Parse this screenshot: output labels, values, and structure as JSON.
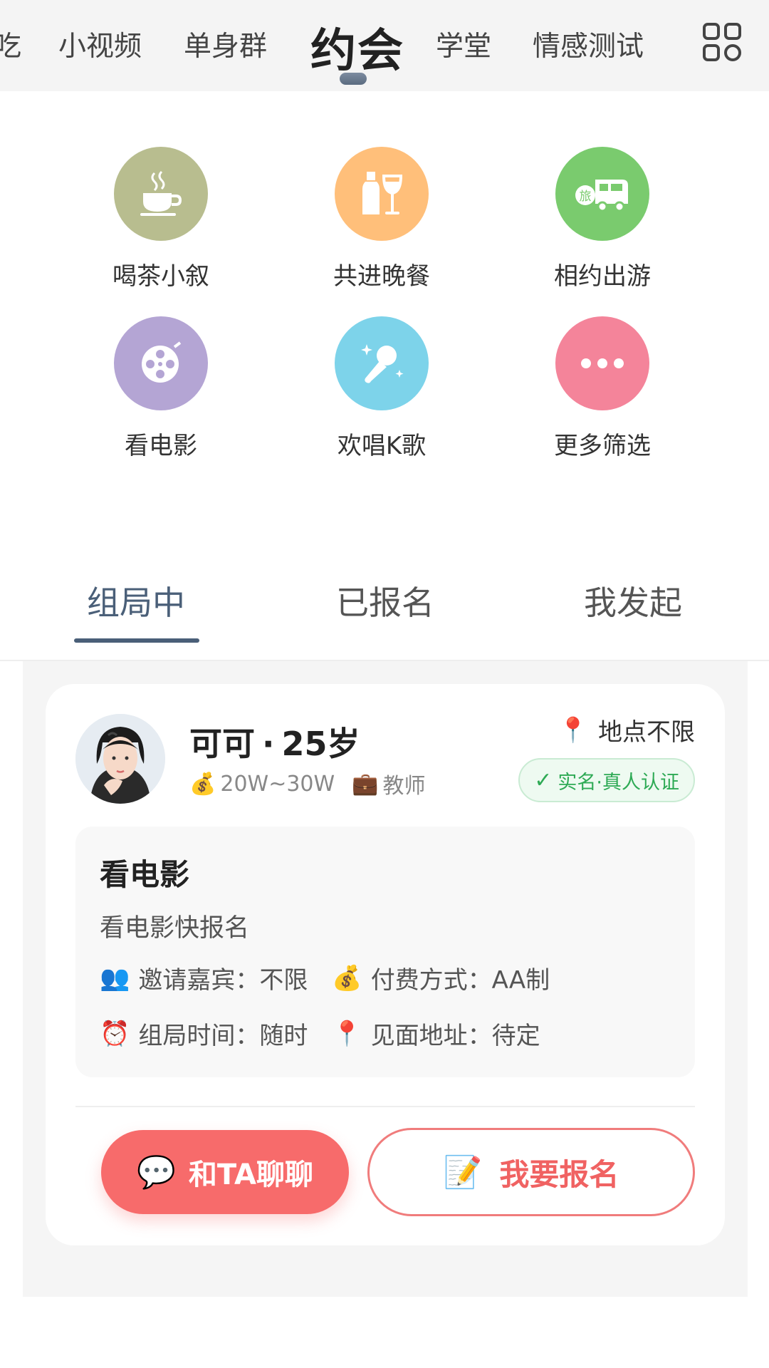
{
  "top_nav": {
    "partial_item": "吃",
    "items": [
      "小视频",
      "单身群",
      "约会",
      "学堂",
      "情感测试"
    ],
    "active_index": 2
  },
  "categories": [
    {
      "label": "喝茶小叙",
      "icon": "tea-cup-icon",
      "color": "#b8bd8f"
    },
    {
      "label": "共进晚餐",
      "icon": "dinner-bottle-glass-icon",
      "color": "#ffbf7a"
    },
    {
      "label": "相约出游",
      "icon": "travel-bus-icon",
      "color": "#7acb6e"
    },
    {
      "label": "看电影",
      "icon": "film-reel-icon",
      "color": "#b4a5d4"
    },
    {
      "label": "欢唱K歌",
      "icon": "microphone-icon",
      "color": "#7dd3ea"
    },
    {
      "label": "更多筛选",
      "icon": "more-dots-icon",
      "color": "#f4849a"
    }
  ],
  "tabs": {
    "items": [
      "组局中",
      "已报名",
      "我发起"
    ],
    "active_index": 0
  },
  "card": {
    "name": "可可",
    "separator": "·",
    "age": "25岁",
    "income": "20W~30W",
    "job": "教师",
    "location": "地点不限",
    "verified": "实名·真人认证",
    "activity_title": "看电影",
    "activity_desc": "看电影快报名",
    "invite_label": "邀请嘉宾：不限",
    "pay_label": "付费方式：AA制",
    "time_label": "组局时间：随时",
    "address_label": "见面地址：待定",
    "chat_button": "和TA聊聊",
    "join_button": "我要报名"
  },
  "colors": {
    "accent": "#4a5f78",
    "primary_red": "#f76b6b",
    "verify_green": "#2eaa55"
  }
}
